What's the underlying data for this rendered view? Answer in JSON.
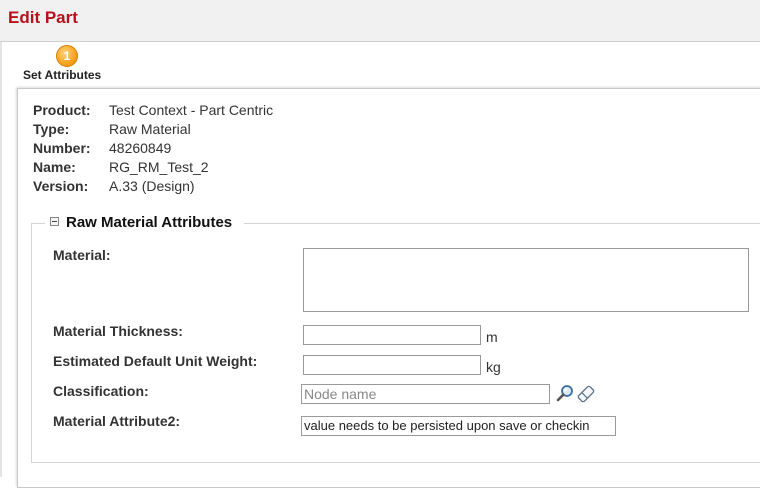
{
  "window": {
    "title": "Edit Part"
  },
  "wizard": {
    "step_number": "1",
    "step_label": "Set Attributes"
  },
  "details": [
    {
      "label": "Product:",
      "value": "Test Context - Part Centric"
    },
    {
      "label": "Type:",
      "value": "Raw Material"
    },
    {
      "label": "Number:",
      "value": "48260849"
    },
    {
      "label": "Name:",
      "value": "RG_RM_Test_2"
    },
    {
      "label": "Version:",
      "value": "A.33 (Design)"
    }
  ],
  "section": {
    "title": "Raw Material Attributes",
    "fields": {
      "material": {
        "label": "Material:",
        "value": ""
      },
      "thickness": {
        "label": "Material Thickness:",
        "value": "",
        "unit": "m"
      },
      "weight": {
        "label": "Estimated Default Unit Weight:",
        "value": "",
        "unit": "kg"
      },
      "classification": {
        "label": "Classification:",
        "placeholder": "Node name"
      },
      "attribute2": {
        "label": "Material Attribute2:",
        "value": "value needs to be persisted upon save or checkin"
      }
    }
  },
  "icons": {
    "search": "magnifier-icon",
    "clear": "eraser-icon",
    "collapse": "collapse-icon"
  },
  "colors": {
    "title": "#b5121b",
    "step_badge": "#f6a21e"
  }
}
